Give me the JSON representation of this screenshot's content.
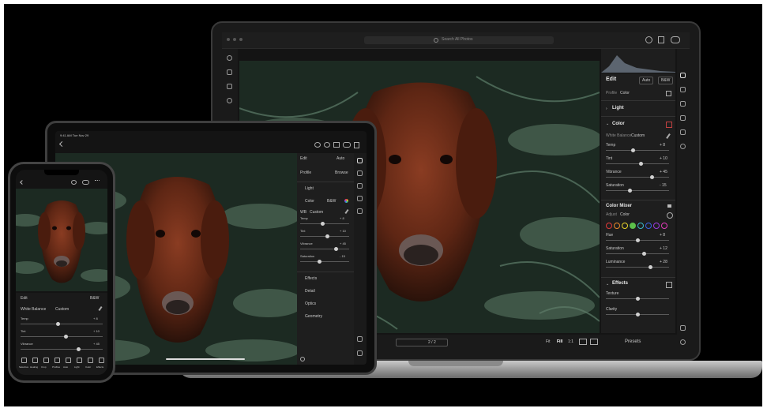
{
  "laptop": {
    "search_placeholder": "Search All Photos",
    "edit_title": "Edit",
    "auto_btn": "Auto",
    "bw_btn": "B&W",
    "profile_label": "Profile",
    "profile_value": "Color",
    "sections": {
      "light": "Light",
      "color": "Color",
      "effects": "Effects"
    },
    "white_balance_label": "White Balance",
    "white_balance_value": "Custom",
    "sliders_color": [
      {
        "label": "Temp",
        "value": "+ 8",
        "pos": 0.42
      },
      {
        "label": "Tint",
        "value": "+ 10",
        "pos": 0.55
      },
      {
        "label": "Vibrance",
        "value": "+ 45",
        "pos": 0.72
      },
      {
        "label": "Saturation",
        "value": "- 15",
        "pos": 0.38
      }
    ],
    "color_mixer_title": "Color Mixer",
    "adjust_label": "Adjust",
    "adjust_value": "Color",
    "swatches": [
      "#e03a3a",
      "#e8892a",
      "#e8d52a",
      "#5cc04a",
      "#3ab8c8",
      "#3a62e0",
      "#9a3ae0",
      "#e03ab8"
    ],
    "sliders_mixer": [
      {
        "label": "Hue",
        "value": "+ 8",
        "pos": 0.5
      },
      {
        "label": "Saturation",
        "value": "+ 12",
        "pos": 0.6
      },
      {
        "label": "Luminance",
        "value": "+ 28",
        "pos": 0.7
      }
    ],
    "sliders_effects": [
      {
        "label": "Texture",
        "value": "",
        "pos": 0.5
      },
      {
        "label": "Clarity",
        "value": "",
        "pos": 0.5
      }
    ],
    "fit_label": "Fit",
    "fill_label": "Fill",
    "ratio_label": "1:1",
    "presets_label": "Presets",
    "filmstrip_count": "2 / 2"
  },
  "tablet": {
    "status_time": "9:41 AM  Tue Nov 29",
    "edit_title": "Edit",
    "auto_btn": "Auto",
    "profile_label": "Profile",
    "profile_value": "Browse",
    "sections": {
      "light": "Light",
      "color": "Color",
      "effects": "Effects",
      "detail": "Detail",
      "optics": "Optics",
      "geometry": "Geometry"
    },
    "bw_label": "B&W",
    "wb_label": "WB",
    "wb_value": "Custom",
    "sliders": [
      {
        "label": "Temp",
        "value": "+ 8",
        "pos": 0.45
      },
      {
        "label": "Tint",
        "value": "+ 10",
        "pos": 0.55
      },
      {
        "label": "Vibrance",
        "value": "+ 45",
        "pos": 0.72
      },
      {
        "label": "Saturation",
        "value": "- 15",
        "pos": 0.38
      }
    ]
  },
  "phone": {
    "edit_label": "Edit",
    "wb_section": "B&W",
    "white_balance_label": "White Balance",
    "white_balance_value": "Custom",
    "sliders": [
      {
        "label": "Temp",
        "value": "+ 8",
        "pos": 0.45
      },
      {
        "label": "Tint",
        "value": "+ 10",
        "pos": 0.55
      },
      {
        "label": "Vibrance",
        "value": "+ 45",
        "pos": 0.7
      }
    ],
    "tools": [
      "Selective",
      "Healing",
      "Crop",
      "Profiles",
      "Auto",
      "Light",
      "Color",
      "Effects"
    ]
  }
}
